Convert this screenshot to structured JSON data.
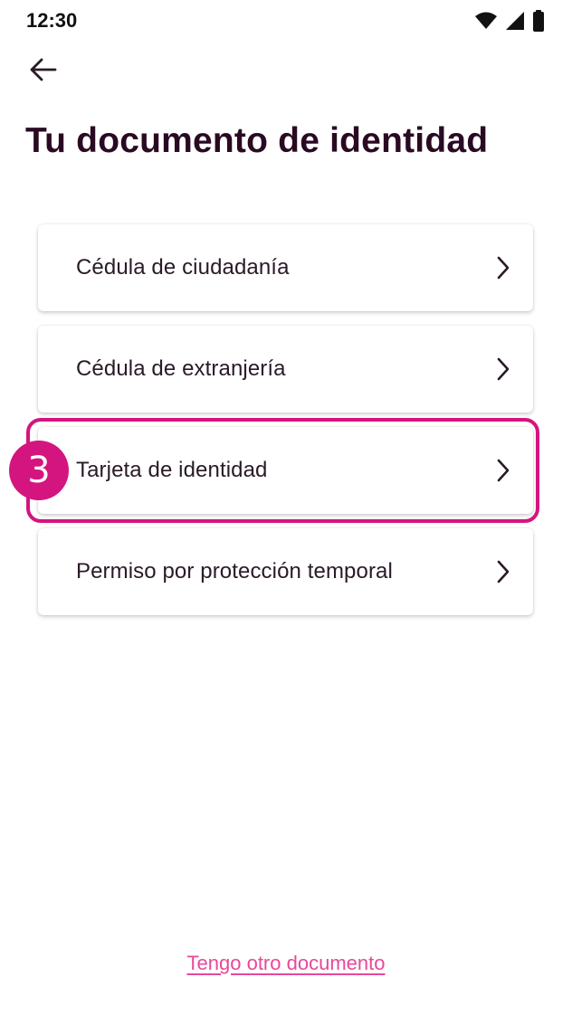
{
  "status_bar": {
    "time": "12:30",
    "icons": [
      "wifi-icon",
      "signal-icon",
      "battery-icon"
    ]
  },
  "header": {
    "back_icon": "arrow-left-icon"
  },
  "page": {
    "title": "Tu documento de identidad"
  },
  "options": [
    {
      "label": "Cédula de ciudadanía",
      "icon": "chevron-right-icon"
    },
    {
      "label": "Cédula de extranjería",
      "icon": "chevron-right-icon"
    },
    {
      "label": "Tarjeta de identidad",
      "icon": "chevron-right-icon",
      "highlighted": true
    },
    {
      "label": "Permiso por protección temporal",
      "icon": "chevron-right-icon"
    }
  ],
  "annotation": {
    "step_number": "3"
  },
  "footer": {
    "link_label": "Tengo otro documento"
  },
  "colors": {
    "accent": "#d4157f",
    "link": "#e8489a",
    "title": "#2a0a22"
  }
}
